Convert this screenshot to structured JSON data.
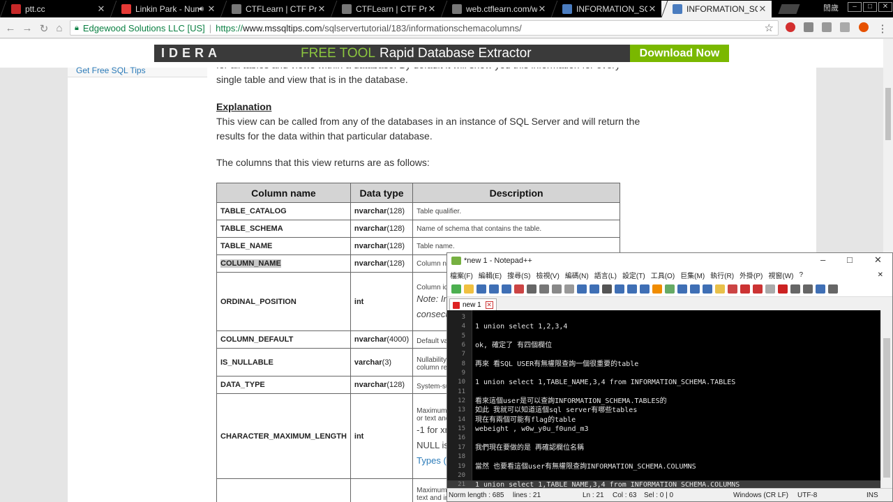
{
  "browser": {
    "tabs": [
      {
        "title": "ptt.cc",
        "fav_color": "#c62828",
        "active": false
      },
      {
        "title": "Linkin Park - Numb",
        "fav_color": "#e53935",
        "active": false,
        "audio": true
      },
      {
        "title": "CTFLearn | CTF Practice",
        "fav_color": "#777777",
        "active": false
      },
      {
        "title": "CTFLearn | CTF Practice",
        "fav_color": "#777777",
        "active": false
      },
      {
        "title": "web.ctflearn.com/web",
        "fav_color": "#777777",
        "active": false
      },
      {
        "title": "INFORMATION_SCHEMA",
        "fav_color": "#4a7cbf",
        "active": false
      },
      {
        "title": "INFORMATION_SCHEMA",
        "fav_color": "#4a7cbf",
        "active": true
      }
    ],
    "user_label": "誾歲",
    "address": {
      "ev_name": "Edgewood Solutions LLC [US]",
      "url_https": "https://",
      "url_host": "www.mssqltips.com",
      "url_path": "/sqlservertutorial/183/informationschemacolumns/"
    }
  },
  "page": {
    "ad": {
      "logo": "IDERA",
      "free_tool": "FREE TOOL",
      "product": "Rapid Database Extractor",
      "cta": "Download Now"
    },
    "sidebar_link": "Get Free SQL Tips",
    "intro_line1": "for all tables and views within a database. By default it will show you this information for every",
    "intro_line2": "single table and view that is in the database.",
    "heading": "Explanation",
    "explanation_line1": "This view can be called from any of the databases in an instance of SQL Server and will return the",
    "explanation_line2": "results for the data within that particular database.",
    "columns_intro": "The columns that this view returns are as follows:",
    "table": {
      "headers": [
        "Column name",
        "Data type",
        "Description"
      ],
      "rows": [
        {
          "name": "TABLE_CATALOG",
          "type_bold": "nvarchar",
          "type_rest": "(128)",
          "desc": "Table qualifier.",
          "h": 25
        },
        {
          "name": "TABLE_SCHEMA",
          "type_bold": "nvarchar",
          "type_rest": "(128)",
          "desc": "Name of schema that contains the table.",
          "h": 25
        },
        {
          "name": "TABLE_NAME",
          "type_bold": "nvarchar",
          "type_rest": "(128)",
          "desc": "Table name.",
          "h": 25
        },
        {
          "name": "COLUMN_NAME",
          "type_bold": "nvarchar",
          "type_rest": "(128)",
          "desc": "Column nam",
          "h": 25,
          "highlight": true
        },
        {
          "name": "ORDINAL_POSITION",
          "type_bold": "int",
          "type_rest": "",
          "desc": "Column ider",
          "desc2": "Note: In S",
          "desc3": "consecuti",
          "h": 84
        },
        {
          "name": "COLUMN_DEFAULT",
          "type_bold": "nvarchar",
          "type_rest": "(4000)",
          "desc": "Default valu",
          "h": 25
        },
        {
          "name": "IS_NULLABLE",
          "type_bold": "varchar",
          "type_rest": "(3)",
          "desc": "Nullability of",
          "desc2": "column retur",
          "h": 40
        },
        {
          "name": "DATA_TYPE",
          "type_bold": "nvarchar",
          "type_rest": "(128)",
          "desc": "System-sup",
          "h": 25
        },
        {
          "name": "CHARACTER_MAXIMUM_LENGTH",
          "type_bold": "int",
          "type_rest": "",
          "desc": "Maximum le",
          "desc2": "or text and i",
          "desc3": "-1 for xml",
          "desc4": "NULL is r",
          "desc5": "Types (Tra",
          "h": 122
        },
        {
          "name": "",
          "type_bold": "",
          "type_rest": "",
          "desc": "Maximum le",
          "desc2": "text and ima",
          "h": 40
        }
      ]
    }
  },
  "notepad": {
    "title": "*new 1 - Notepad++",
    "menu": [
      "檔案(F)",
      "編輯(E)",
      "搜尋(S)",
      "檢視(V)",
      "編碼(N)",
      "語言(L)",
      "設定(T)",
      "工具(O)",
      "巨集(M)",
      "執行(R)",
      "外掛(P)",
      "視窗(W)",
      "?"
    ],
    "tab_label": "new 1",
    "lines": [
      {
        "n": "3",
        "t": ""
      },
      {
        "n": "4",
        "t": "1 union select 1,2,3,4"
      },
      {
        "n": "5",
        "t": ""
      },
      {
        "n": "6",
        "t": "ok, 確定了 有四個欄位"
      },
      {
        "n": "7",
        "t": ""
      },
      {
        "n": "8",
        "t": "再來 看SQL USER有無權限查詢一個很重要的table"
      },
      {
        "n": "9",
        "t": ""
      },
      {
        "n": "10",
        "t": "1 union select 1,TABLE_NAME,3,4 from INFORMATION_SCHEMA.TABLES"
      },
      {
        "n": "11",
        "t": ""
      },
      {
        "n": "12",
        "t": "看來這個user是可以查詢INFORMATION_SCHEMA.TABLES的"
      },
      {
        "n": "13",
        "t": "如此 我就可以知道這個sql server有哪些tables"
      },
      {
        "n": "14",
        "t": "現在有兩個可能有flag的table"
      },
      {
        "n": "15",
        "t": "webeight , w0w_y0u_f0und_m3"
      },
      {
        "n": "16",
        "t": ""
      },
      {
        "n": "17",
        "t": "我們現在要做的是 再確認欄位名稱"
      },
      {
        "n": "18",
        "t": ""
      },
      {
        "n": "19",
        "t": "當然 也要看這個user有無權限查詢INFORMATION_SCHEMA.COLUMNS"
      },
      {
        "n": "20",
        "t": ""
      },
      {
        "n": "21",
        "t": "1 union select 1,TABLE_NAME,3,4 from INFORMATION_SCHEMA.COLUMNS",
        "current": true
      }
    ],
    "status": {
      "length": "Norm length : 685",
      "lines": "lines : 21",
      "ln": "Ln : 21",
      "col": "Col : 63",
      "sel": "Sel : 0 | 0",
      "eol": "Windows (CR LF)",
      "enc": "UTF-8",
      "mode": "INS"
    }
  }
}
